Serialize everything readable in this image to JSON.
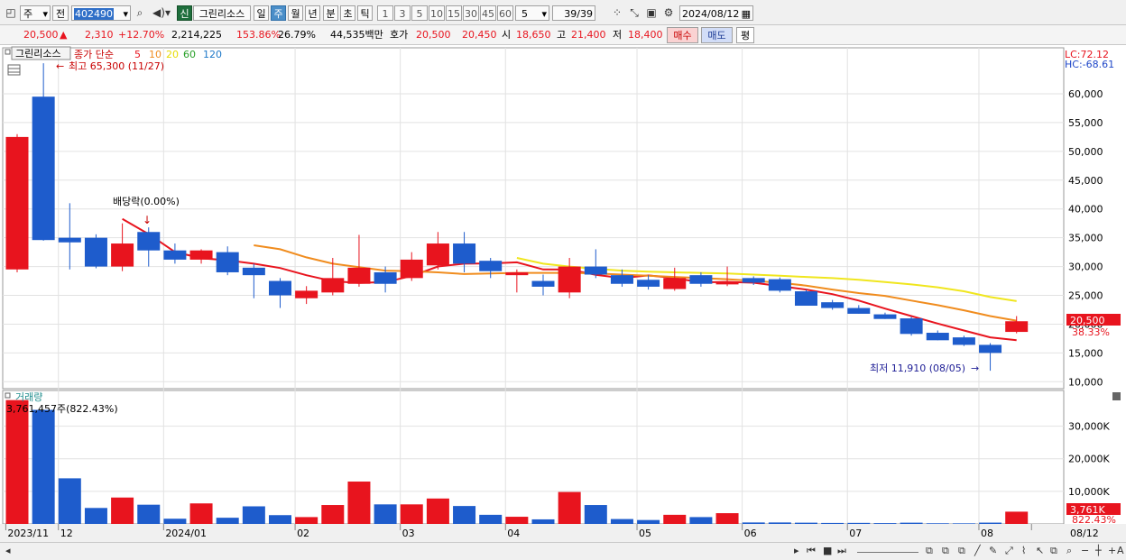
{
  "toolbar": {
    "market": "주",
    "prev_label": "전",
    "code": "402490",
    "stock_name": "그린리소스",
    "new_badge": "신",
    "periods": [
      "일",
      "주",
      "월",
      "년",
      "분",
      "초",
      "틱"
    ],
    "active_period": "주",
    "intervals": [
      "1",
      "3",
      "5",
      "10",
      "15",
      "30",
      "45",
      "60"
    ],
    "count_value": "5",
    "page_count": "39/39",
    "date": "2024/08/12"
  },
  "quote": {
    "price": "20,500",
    "change_arrow": "▲",
    "change": "2,310",
    "change_pct": "+12.70%",
    "volume": "2,214,225",
    "volume_ratio": "153.86%",
    "turnover": "26.79%",
    "amount": "44,535백만",
    "ask_label": "호가",
    "ask": "20,500",
    "bid": "20,450",
    "open_label": "시",
    "open": "18,650",
    "high_label": "고",
    "high": "21,400",
    "low_label": "저",
    "low": "18,400",
    "buy_label": "매수",
    "sell_label": "매도",
    "eval_label": "평"
  },
  "price_legend": {
    "name": "그린리소스",
    "ma_label": "종가 단순",
    "periods": [
      "5",
      "10",
      "20",
      "60",
      "120"
    ],
    "lc": "LC:72.12",
    "hc": "HC:-68.61"
  },
  "annotations": {
    "high": "최고 65,300 (11/27)",
    "low": "최저 11,910 (08/05)",
    "dividend": "배당락(0.00%)",
    "last_price": "20,500",
    "last_pct": "38.33%"
  },
  "volume_legend": {
    "title": "거래량",
    "max_info": "3,761,457주(822.43%)",
    "last": "3,761K",
    "last_pct": "822.43%"
  },
  "colors": {
    "up": "#e8141e",
    "down": "#1e5ccc",
    "ma5": "#e8141e",
    "ma10": "#f08c1e",
    "ma20": "#f0e61e",
    "ma60": "#28a028",
    "ma120": "#1e78c8"
  },
  "chart_data": {
    "type": "candlestick",
    "timeframe": "weekly",
    "y_price_ticks": [
      "60,000",
      "55,000",
      "50,000",
      "45,000",
      "40,000",
      "35,000",
      "30,000",
      "25,000",
      "20,000",
      "15,000",
      "10,000"
    ],
    "y_volume_ticks": [
      "30,000K",
      "20,000K",
      "10,000K"
    ],
    "x_labels": [
      {
        "i": 0,
        "label": "2023/11"
      },
      {
        "i": 2,
        "label": "12"
      },
      {
        "i": 6,
        "label": "2024/01"
      },
      {
        "i": 11,
        "label": "02"
      },
      {
        "i": 15,
        "label": "03"
      },
      {
        "i": 19,
        "label": "04"
      },
      {
        "i": 24,
        "label": "05"
      },
      {
        "i": 28,
        "label": "06"
      },
      {
        "i": 32,
        "label": "07"
      },
      {
        "i": 37,
        "label": "08"
      },
      {
        "i": 39,
        "label": "08/12"
      }
    ],
    "candles": [
      {
        "o": 29500,
        "h": 53000,
        "l": 29000,
        "c": 52500,
        "v": 38000
      },
      {
        "o": 59500,
        "h": 65300,
        "l": 34500,
        "c": 34600,
        "v": 35000
      },
      {
        "o": 35000,
        "h": 41000,
        "l": 29500,
        "c": 34200,
        "v": 14000
      },
      {
        "o": 35000,
        "h": 35600,
        "l": 29700,
        "c": 30000,
        "v": 4900
      },
      {
        "o": 30000,
        "h": 37500,
        "l": 29200,
        "c": 34000,
        "v": 8100
      },
      {
        "o": 36000,
        "h": 36800,
        "l": 30000,
        "c": 32800,
        "v": 5900
      },
      {
        "o": 32800,
        "h": 34000,
        "l": 30500,
        "c": 31200,
        "v": 1600
      },
      {
        "o": 31200,
        "h": 33000,
        "l": 30500,
        "c": 32800,
        "v": 6300
      },
      {
        "o": 32500,
        "h": 33500,
        "l": 28500,
        "c": 29000,
        "v": 1900
      },
      {
        "o": 29800,
        "h": 30500,
        "l": 24500,
        "c": 28500,
        "v": 5400
      },
      {
        "o": 27500,
        "h": 28000,
        "l": 22800,
        "c": 25000,
        "v": 2700
      },
      {
        "o": 24500,
        "h": 26600,
        "l": 23500,
        "c": 25800,
        "v": 2100
      },
      {
        "o": 25500,
        "h": 31500,
        "l": 25000,
        "c": 28000,
        "v": 5800
      },
      {
        "o": 27000,
        "h": 35500,
        "l": 26500,
        "c": 29800,
        "v": 13000
      },
      {
        "o": 29000,
        "h": 30000,
        "l": 25500,
        "c": 27000,
        "v": 6000
      },
      {
        "o": 28000,
        "h": 32500,
        "l": 27500,
        "c": 31200,
        "v": 6000
      },
      {
        "o": 30200,
        "h": 36000,
        "l": 29500,
        "c": 34000,
        "v": 7800
      },
      {
        "o": 34000,
        "h": 36000,
        "l": 29000,
        "c": 30500,
        "v": 5500
      },
      {
        "o": 31000,
        "h": 31500,
        "l": 28000,
        "c": 29200,
        "v": 2800
      },
      {
        "o": 28500,
        "h": 29500,
        "l": 25500,
        "c": 29000,
        "v": 2200
      },
      {
        "o": 27500,
        "h": 28600,
        "l": 25000,
        "c": 26500,
        "v": 1400
      },
      {
        "o": 25500,
        "h": 31500,
        "l": 24500,
        "c": 30000,
        "v": 9800
      },
      {
        "o": 30000,
        "h": 33000,
        "l": 28000,
        "c": 28600,
        "v": 5800
      },
      {
        "o": 28500,
        "h": 29500,
        "l": 26500,
        "c": 27000,
        "v": 1500
      },
      {
        "o": 27700,
        "h": 28500,
        "l": 26000,
        "c": 26500,
        "v": 1200
      },
      {
        "o": 26100,
        "h": 29800,
        "l": 25800,
        "c": 28000,
        "v": 2800
      },
      {
        "o": 28500,
        "h": 29000,
        "l": 26500,
        "c": 27000,
        "v": 2100
      },
      {
        "o": 26900,
        "h": 30000,
        "l": 26600,
        "c": 27400,
        "v": 3300
      },
      {
        "o": 28000,
        "h": 28300,
        "l": 26800,
        "c": 27200,
        "v": 450
      },
      {
        "o": 27800,
        "h": 28100,
        "l": 25500,
        "c": 25800,
        "v": 450
      },
      {
        "o": 25700,
        "h": 26000,
        "l": 23200,
        "c": 23200,
        "v": 380
      },
      {
        "o": 23800,
        "h": 24200,
        "l": 22500,
        "c": 22800,
        "v": 300
      },
      {
        "o": 22800,
        "h": 23300,
        "l": 21800,
        "c": 21800,
        "v": 320
      },
      {
        "o": 21700,
        "h": 22000,
        "l": 20900,
        "c": 20900,
        "v": 250
      },
      {
        "o": 21000,
        "h": 21300,
        "l": 18000,
        "c": 18300,
        "v": 380
      },
      {
        "o": 18500,
        "h": 18900,
        "l": 17200,
        "c": 17200,
        "v": 200
      },
      {
        "o": 17700,
        "h": 18000,
        "l": 16200,
        "c": 16400,
        "v": 180
      },
      {
        "o": 16400,
        "h": 16700,
        "l": 11910,
        "c": 15000,
        "v": 400
      },
      {
        "o": 18650,
        "h": 21400,
        "l": 18400,
        "c": 20500,
        "v": 3761
      }
    ],
    "ma_lines": [
      {
        "name": "5",
        "color": "#e8141e",
        "values": [
          null,
          null,
          null,
          null,
          38260,
          35640,
          32530,
          31440,
          31100,
          30500,
          29740,
          28500,
          27460,
          27140,
          27300,
          28360,
          30020,
          30500,
          30540,
          30740,
          29500,
          29480,
          28560,
          28000,
          28460,
          28000,
          27260,
          27340,
          27200,
          26600,
          26000,
          25200,
          24100,
          22700,
          21400,
          20100,
          18900,
          17700,
          17200
        ]
      },
      {
        "name": "10",
        "color": "#f08c1e",
        "values": [
          null,
          null,
          null,
          null,
          null,
          null,
          null,
          null,
          null,
          33700,
          33000,
          31600,
          30500,
          29900,
          29300,
          29200,
          29000,
          28700,
          28800,
          28900,
          28900,
          28900,
          28800,
          28600,
          28400,
          28200,
          28000,
          27800,
          27500,
          27200,
          26700,
          26000,
          25400,
          24900,
          24100,
          23300,
          22400,
          21400,
          20600
        ]
      },
      {
        "name": "20",
        "color": "#f0e61e",
        "values": [
          null,
          null,
          null,
          null,
          null,
          null,
          null,
          null,
          null,
          null,
          null,
          null,
          null,
          null,
          null,
          null,
          null,
          null,
          null,
          31500,
          30500,
          30000,
          29600,
          29300,
          29100,
          29000,
          28900,
          28800,
          28600,
          28400,
          28200,
          28000,
          27700,
          27300,
          26900,
          26400,
          25700,
          24700,
          24000
        ]
      }
    ]
  }
}
